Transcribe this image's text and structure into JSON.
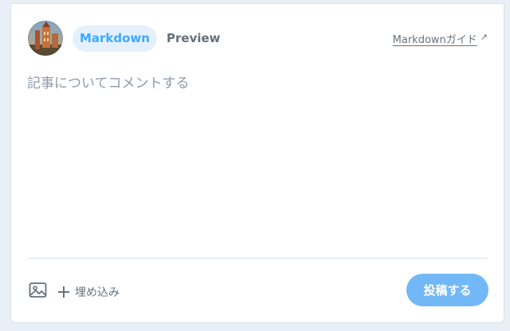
{
  "editor": {
    "tabs": [
      {
        "label": "Markdown",
        "active": true
      },
      {
        "label": "Preview",
        "active": false
      }
    ],
    "guide_link": "Markdownガイド",
    "placeholder": "記事についてコメントする",
    "value": ""
  },
  "toolbar": {
    "image_icon": "image-icon",
    "embed_label": "埋め込み",
    "submit_label": "投稿する"
  },
  "colors": {
    "accent": "#3ea8ff",
    "tab_active_bg": "#e4f1fc",
    "submit_bg": "#72b8f7",
    "muted_text": "#65717b",
    "page_bg": "#e9eff6"
  }
}
